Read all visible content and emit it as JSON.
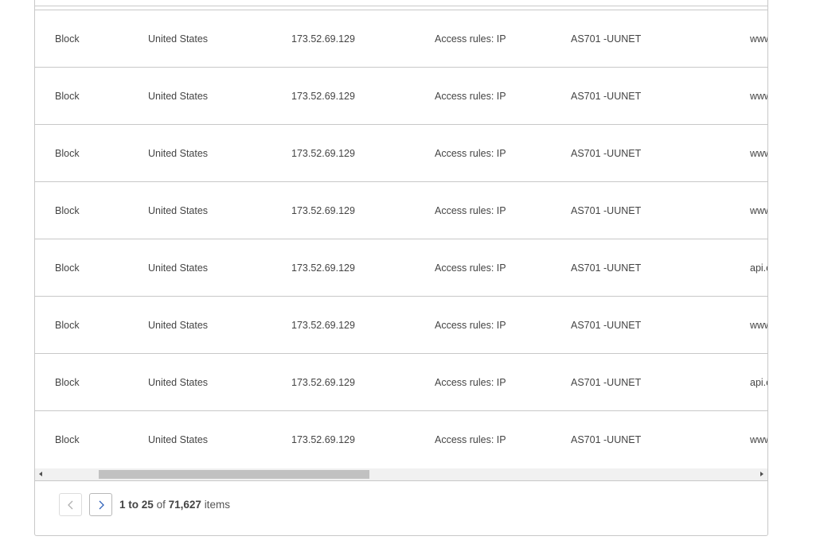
{
  "table": {
    "rows": [
      {
        "action": "Block",
        "country": "United States",
        "ip": "173.52.69.129",
        "service": "Access rules: IP",
        "asn": "AS701 -UUNET",
        "host": "www.example.com"
      },
      {
        "action": "Block",
        "country": "United States",
        "ip": "173.52.69.129",
        "service": "Access rules: IP",
        "asn": "AS701 -UUNET",
        "host": "www.example.com"
      },
      {
        "action": "Block",
        "country": "United States",
        "ip": "173.52.69.129",
        "service": "Access rules: IP",
        "asn": "AS701 -UUNET",
        "host": "www.example.com"
      },
      {
        "action": "Block",
        "country": "United States",
        "ip": "173.52.69.129",
        "service": "Access rules: IP",
        "asn": "AS701 -UUNET",
        "host": "www.example.com"
      },
      {
        "action": "Block",
        "country": "United States",
        "ip": "173.52.69.129",
        "service": "Access rules: IP",
        "asn": "AS701 -UUNET",
        "host": "api.example.com"
      },
      {
        "action": "Block",
        "country": "United States",
        "ip": "173.52.69.129",
        "service": "Access rules: IP",
        "asn": "AS701 -UUNET",
        "host": "www.example.com"
      },
      {
        "action": "Block",
        "country": "United States",
        "ip": "173.52.69.129",
        "service": "Access rules: IP",
        "asn": "AS701 -UUNET",
        "host": "api.example.com"
      },
      {
        "action": "Block",
        "country": "United States",
        "ip": "173.52.69.129",
        "service": "Access rules: IP",
        "asn": "AS701 -UUNET",
        "host": "www.example.com"
      }
    ]
  },
  "scrollbar": {
    "left_arrow_icon": "triangle-left-icon",
    "right_arrow_icon": "triangle-right-icon"
  },
  "pagination": {
    "prev_icon": "chevron-left-icon",
    "next_icon": "chevron-right-icon",
    "range_start": "1",
    "range_to": "to",
    "range_end": "25",
    "of_label": "of",
    "total": "71,627",
    "items_label": "items"
  },
  "colors": {
    "border": "#c8c8c8",
    "next_chevron": "#2c5fb8",
    "prev_chevron": "#b0b0b0"
  }
}
